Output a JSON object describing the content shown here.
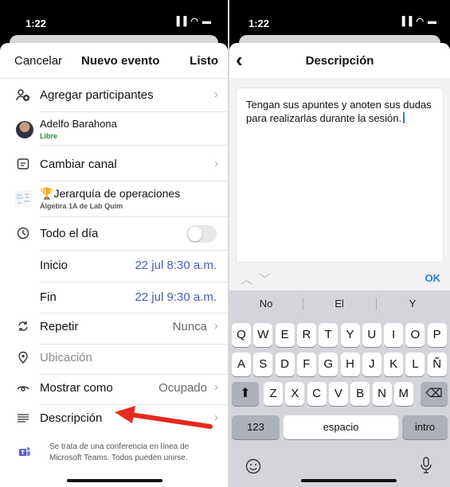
{
  "left": {
    "status": {
      "time": "1:22",
      "icons": "▐▐ ◠ ▬"
    },
    "nav": {
      "cancel": "Cancelar",
      "title": "Nuevo evento",
      "done": "Listo"
    },
    "rows": {
      "participants": "Agregar participantes",
      "person_name": "Adelfo Barahona",
      "person_status": "Libre",
      "channel": "Cambiar canal",
      "team_title": "Jerarquía de operaciones",
      "team_sub": "Álgebra 1A de Lab Quim",
      "allday": "Todo el día",
      "start_label": "Inicio",
      "start_value": "22 jul 8:30 a.m.",
      "end_label": "Fin",
      "end_value": "22 jul 9:30 a.m.",
      "repeat_label": "Repetir",
      "repeat_value": "Nunca",
      "location": "Ubicación",
      "show_as_label": "Mostrar como",
      "show_as_value": "Ocupado",
      "description": "Descripción",
      "teams_note_line1": "Se trata de una conferencia en línea de",
      "teams_note_line2": "Microsoft Teams. Todos pueden unirse."
    },
    "colors": {
      "accent_blue": "#4a5bc0",
      "free_green": "#2e8b3a",
      "arrow_red": "#e8291c",
      "teams_purple": "#5b5fc7"
    }
  },
  "right": {
    "status": {
      "time": "1:22",
      "icons": "▐▐ ◠ ▬"
    },
    "nav": {
      "back": "‹",
      "title": "Descripción"
    },
    "description_text": "Tengan sus apuntes y anoten sus dudas para realizarlas durante la sesión.",
    "keyboard": {
      "ok": "OK",
      "suggestions": [
        "No",
        "El",
        "Y"
      ],
      "row1": [
        "Q",
        "W",
        "E",
        "R",
        "T",
        "Y",
        "U",
        "I",
        "O",
        "P"
      ],
      "row2": [
        "A",
        "S",
        "D",
        "F",
        "G",
        "H",
        "J",
        "K",
        "L",
        "Ñ"
      ],
      "row3": [
        "Z",
        "X",
        "C",
        "V",
        "B",
        "N",
        "M"
      ],
      "numbers": "123",
      "space": "espacio",
      "return": "intro"
    }
  }
}
